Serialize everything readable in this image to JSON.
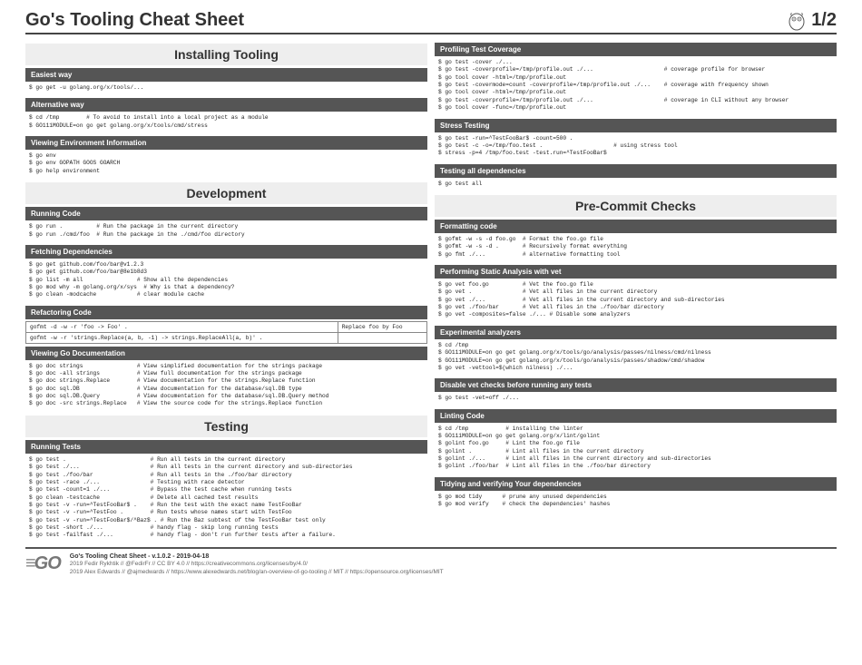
{
  "header": {
    "title": "Go's Tooling Cheat Sheet",
    "page": "1/2"
  },
  "left": {
    "s1_title": "Installing Tooling",
    "s1a_head": "Easiest way",
    "s1a_code": "$ go get -u golang.org/x/tools/...",
    "s1b_head": "Alternative way",
    "s1b_code": "$ cd /tmp        # To avoid to install into a local project as a module\n$ GO111MODULE=on go get golang.org/x/tools/cmd/stress",
    "s1c_head": "Viewing Environment Information",
    "s1c_code": "$ go env\n$ go env GOPATH GOOS GOARCH\n$ go help environment",
    "s2_title": "Development",
    "s2a_head": "Running Code",
    "s2a_code": "$ go run .          # Run the package in the current directory\n$ go run ./cmd/foo  # Run the package in the ./cmd/foo directory",
    "s2b_head": "Fetching Dependencies",
    "s2b_code": "$ go get github.com/foo/bar@v1.2.3\n$ go get github.com/foo/bar@8e1b8d3\n$ go list -m all                # Show all the dependencies\n$ go mod why -m golang.org/x/sys  # Why is that a dependency?\n$ go clean -modcache            # clear module cache",
    "s2c_head": "Refactoring Code",
    "refactor": [
      [
        "gofmt -d -w -r 'foo -> Foo' .",
        "Replace foo by Foo"
      ],
      [
        "gofmt -w -r 'strings.Replace(a, b, -1) -> strings.ReplaceAll(a, b)' .",
        ""
      ]
    ],
    "s2d_head": "Viewing Go Documentation",
    "s2d_code": "$ go doc strings                # View simplified documentation for the strings package\n$ go doc -all strings           # View full documentation for the strings package\n$ go doc strings.Replace        # View documentation for the strings.Replace function\n$ go doc sql.DB                 # View documentation for the database/sql.DB type\n$ go doc sql.DB.Query           # View documentation for the database/sql.DB.Query method\n$ go doc -src strings.Replace   # View the source code for the strings.Replace function",
    "s3_title": "Testing",
    "s3a_head": "Running Tests",
    "s3a_code": "$ go test .                         # Run all tests in the current directory\n$ go test ./...                     # Run all tests in the current directory and sub-directories\n$ go test ./foo/bar                 # Run all tests in the ./foo/bar directory\n$ go test -race ./...               # Testing with race detector\n$ go test -count=1 ./...            # Bypass the test cache when running tests\n$ go clean -testcache               # Delete all cached test results\n$ go test -v -run=^TestFooBar$ .    # Run the test with the exact name TestFooBar\n$ go test -v -run=^TestFoo .        # Run tests whose names start with TestFoo\n$ go test -v -run=^TestFooBar$/^Baz$ . # Run the Baz subtest of the TestFooBar test only\n$ go test -short ./...              # handy flag - skip long running tests\n$ go test -failfast ./...           # handy flag - don't run further tests after a failure."
  },
  "right": {
    "r1_head": "Profiling Test Coverage",
    "r1_code": "$ go test -cover ./...\n$ go test -coverprofile=/tmp/profile.out ./...                     # coverage profile for browser\n$ go tool cover -html=/tmp/profile.out\n$ go test -covermode=count -coverprofile=/tmp/profile.out ./...    # coverage with frequency shown\n$ go tool cover -html=/tmp/profile.out\n$ go test -coverprofile=/tmp/profile.out ./...                     # coverage in CLI without any browser\n$ go tool cover -func=/tmp/profile.out",
    "r2_head": "Stress Testing",
    "r2_code": "$ go test -run=^TestFooBar$ -count=500 .\n$ go test -c -o=/tmp/foo.test .                     # using stress tool\n$ stress -p=4 /tmp/foo.test -test.run=^TestFooBar$",
    "r3_head": "Testing all dependencies",
    "r3_code": "$ go test all",
    "s4_title": "Pre-Commit Checks",
    "r4_head": "Formatting code",
    "r4_code": "$ gofmt -w -s -d foo.go  # Format the foo.go file\n$ gofmt -w -s -d .       # Recursively format everything\n$ go fmt ./...           # alternative formatting tool",
    "r5_head": "Performing Static Analysis with vet",
    "r5_code": "$ go vet foo.go          # Vet the foo.go file\n$ go vet .               # Vet all files in the current directory\n$ go vet ./...           # Vet all files in the current directory and sub-directories\n$ go vet ./foo/bar       # Vet all files in the ./foo/bar directory\n$ go vet -composites=false ./... # Disable some analyzers",
    "r6_head": "Experimental analyzers",
    "r6_code": "$ cd /tmp\n$ GO111MODULE=on go get golang.org/x/tools/go/analysis/passes/nilness/cmd/nilness\n$ GO111MODULE=on go get golang.org/x/tools/go/analysis/passes/shadow/cmd/shadow\n$ go vet -vettool=$(which nilness) ./...",
    "r7_head": "Disable vet checks before running any tests",
    "r7_code": "$ go test -vet=off ./...",
    "r8_head": "Linting Code",
    "r8_code": "$ cd /tmp           # installing the linter\n$ GO111MODULE=on go get golang.org/x/lint/golint\n$ golint foo.go     # Lint the foo.go file\n$ golint .          # Lint all files in the current directory\n$ golint ./...      # Lint all files in the current directory and sub-directories\n$ golint ./foo/bar  # Lint all files in the ./foo/bar directory",
    "r9_head": "Tidying and verifying Your dependencies",
    "r9_code": "$ go mod tidy      # prune any unused dependencies\n$ go mod verify    # check the dependencies' hashes"
  },
  "footer": {
    "line1": "Go's Tooling Cheat Sheet - v.1.0.2 - 2019-04-18",
    "line2": "2019 Fedir Rykhtik // @FedirFr // CC BY 4.0 // https://creativecommons.org/licenses/by/4.0/",
    "line3": "2019 Alex Edwards // @ajmedwards // https://www.alexedwards.net/blog/an-overview-of-go-tooling // MIT // https://opensource.org/licenses/MIT"
  }
}
